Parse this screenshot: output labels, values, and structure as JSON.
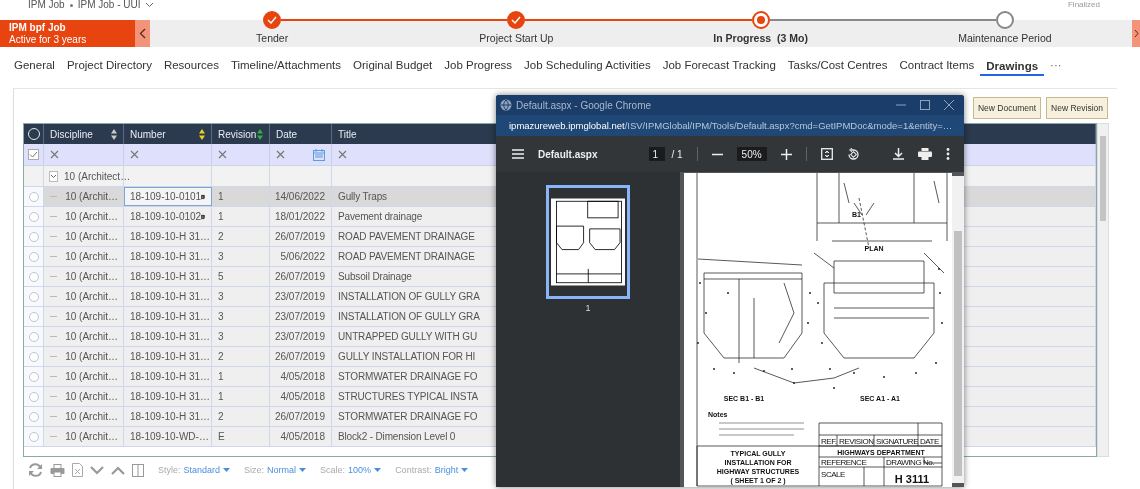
{
  "breadcrumb": [
    "IPM Job",
    "IPM Job - UUI"
  ],
  "status": "Finalized",
  "record": {
    "title": "IPM bpf Job",
    "subtitle": "Active for 3 years"
  },
  "stages": [
    {
      "label": "Tender",
      "kind": "done"
    },
    {
      "label": "Project Start Up",
      "kind": "done"
    },
    {
      "label": "In Progress",
      "duration": "(3 Mo)",
      "kind": "current"
    },
    {
      "label": "Maintenance Period",
      "kind": "upcoming"
    }
  ],
  "tabs": [
    {
      "label": "General",
      "selected": false
    },
    {
      "label": "Project Directory",
      "selected": false
    },
    {
      "label": "Resources",
      "selected": false
    },
    {
      "label": "Timeline/Attachments",
      "selected": false
    },
    {
      "label": "Original Budget",
      "selected": false
    },
    {
      "label": "Job Progress",
      "selected": false
    },
    {
      "label": "Job Scheduling Activities",
      "selected": false
    },
    {
      "label": "Job Forecast Tracking",
      "selected": false
    },
    {
      "label": "Tasks/Cost Centres",
      "selected": false
    },
    {
      "label": "Contract Items",
      "selected": false
    },
    {
      "label": "Drawings",
      "selected": true
    }
  ],
  "tabs_more": "···",
  "actions": [
    "New Document",
    "New Revision"
  ],
  "table": {
    "columns": [
      {
        "label": "Discipline",
        "color": "#c8c8c8"
      },
      {
        "label": "Number",
        "color": "#e8d020"
      },
      {
        "label": "Revision",
        "color": "#30b040"
      },
      {
        "label": "Date"
      },
      {
        "label": "Title"
      }
    ],
    "all_selected": false,
    "filter_all_checked": true,
    "group": {
      "label": "10 (Architect…",
      "expanded": true
    },
    "rows": [
      {
        "discipline": "10 (Archit…",
        "number": "18-109-10-0101",
        "revision": "1",
        "date": "14/06/2022",
        "title": "Gully Traps",
        "selected": true
      },
      {
        "discipline": "10 (Archit…",
        "number": "18-109-10-0102",
        "revision": "1",
        "date": "18/01/2022",
        "title": "Pavement drainage",
        "selected": false
      },
      {
        "discipline": "10 (Archit…",
        "number": "18-109-10-H 31…",
        "revision": "2",
        "date": "26/07/2019",
        "title": "ROAD PAVEMENT DRAINAGE",
        "selected": false
      },
      {
        "discipline": "10 (Archit…",
        "number": "18-109-10-H 31…",
        "revision": "3",
        "date": "5/06/2022",
        "title": "ROAD PAVEMENT DRAINAGE",
        "selected": false
      },
      {
        "discipline": "10 (Archit…",
        "number": "18-109-10-H 31…",
        "revision": "5",
        "date": "26/07/2019",
        "title": "Subsoil Drainage",
        "selected": false
      },
      {
        "discipline": "10 (Archit…",
        "number": "18-109-10-H 31…",
        "revision": "3",
        "date": "23/07/2019",
        "title": "INSTALLATION OF GULLY GRA",
        "selected": false
      },
      {
        "discipline": "10 (Archit…",
        "number": "18-109-10-H 31…",
        "revision": "3",
        "date": "23/07/2019",
        "title": "INSTALLATION OF GULLY GRA",
        "selected": false
      },
      {
        "discipline": "10 (Archit…",
        "number": "18-109-10-H 31…",
        "revision": "3",
        "date": "23/07/2019",
        "title": "UNTRAPPED GULLY WITH GU",
        "selected": false
      },
      {
        "discipline": "10 (Archit…",
        "number": "18-109-10-H 31…",
        "revision": "2",
        "date": "26/07/2019",
        "title": "GULLY INSTALLATION FOR HI",
        "selected": false
      },
      {
        "discipline": "10 (Archit…",
        "number": "18-109-10-H 31…",
        "revision": "1",
        "date": "4/05/2018",
        "title": "STORMWATER DRAINAGE FO",
        "selected": false
      },
      {
        "discipline": "10 (Archit…",
        "number": "18-109-10-H 31…",
        "revision": "1",
        "date": "4/05/2018",
        "title": "STRUCTURES TYPICAL INSTA",
        "selected": false
      },
      {
        "discipline": "10 (Archit…",
        "number": "18-109-10-H 31…",
        "revision": "2",
        "date": "26/07/2019",
        "title": "STORMWATER DRAINAGE FO",
        "selected": false
      },
      {
        "discipline": "10 (Archit…",
        "number": "18-109-10-WD-…",
        "revision": "E",
        "date": "4/05/2018",
        "title": "Block2 - Dimension Level 0",
        "selected": false
      }
    ]
  },
  "grid_footer": [
    {
      "label": "Style:",
      "value": "Standard"
    },
    {
      "label": "Size:",
      "value": "Normal"
    },
    {
      "label": "Scale:",
      "value": "100%"
    },
    {
      "label": "Contrast:",
      "value": "Bright"
    }
  ],
  "popup": {
    "title": "Default.aspx - Google Chrome",
    "url_host": "ipmazureweb.ipmglobal.net",
    "url_path": "/ISV/IPMGlobal/IPM/Tools/Default.aspx?cmd=GetIPMDoc&mode=1&entity=…",
    "pdf": {
      "file": "Default.aspx",
      "page": "1",
      "page_total": "/ 1",
      "zoom": "50%",
      "thumbnails": [
        {
          "label": "1",
          "selected": true
        }
      ],
      "labels": [
        "B1",
        "PLAN",
        "SEC B1 - B1",
        "SEC A1 - A1",
        "Notes",
        "REF.",
        "REVISION",
        "SIGNATURE",
        "DATE",
        "TYPICAL GULLY",
        "INSTALLATION FOR",
        "HIGHWAY STRUCTURES",
        "( SHEET 1 OF 2 )",
        "HIGHWAYS DEPARTMENT",
        "REFERENCE",
        "DRAWING No.",
        "SCALE",
        "H 3111"
      ]
    }
  }
}
